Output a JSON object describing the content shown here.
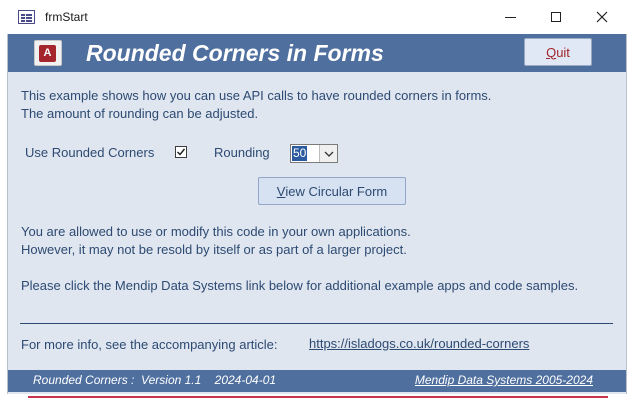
{
  "window": {
    "title": "frmStart"
  },
  "header": {
    "logo_letter": "A",
    "title": "Rounded Corners in Forms",
    "quit_hotkey": "Q",
    "quit_rest": "uit"
  },
  "intro": {
    "line1": "This example shows how you can use API calls to have rounded corners in forms.",
    "line2": "The amount of rounding can be adjusted."
  },
  "options": {
    "use_rounded_label": "Use Rounded Corners",
    "use_rounded_checked": true,
    "rounding_label": "Rounding",
    "rounding_value": "50"
  },
  "circular_button": {
    "hotkey": "V",
    "rest": "iew Circular Form"
  },
  "license": {
    "line1": "You are allowed to use or modify this code in your own applications.",
    "line2": "However, it may not be resold by itself or as part of a larger project."
  },
  "note": "Please click the Mendip Data Systems link below for additional example apps and code samples.",
  "info": {
    "label": "For more info, see the accompanying article:",
    "link": "https://isladogs.co.uk/rounded-corners"
  },
  "footer": {
    "left": "Rounded Corners :  Version 1.1    2024-04-01",
    "right": "Mendip Data Systems 2005-2024"
  },
  "colors": {
    "header_bg": "#4f6f9f",
    "form_bg": "#dfe6ef",
    "text": "#2d4a73",
    "quit_text": "#a4262c"
  }
}
